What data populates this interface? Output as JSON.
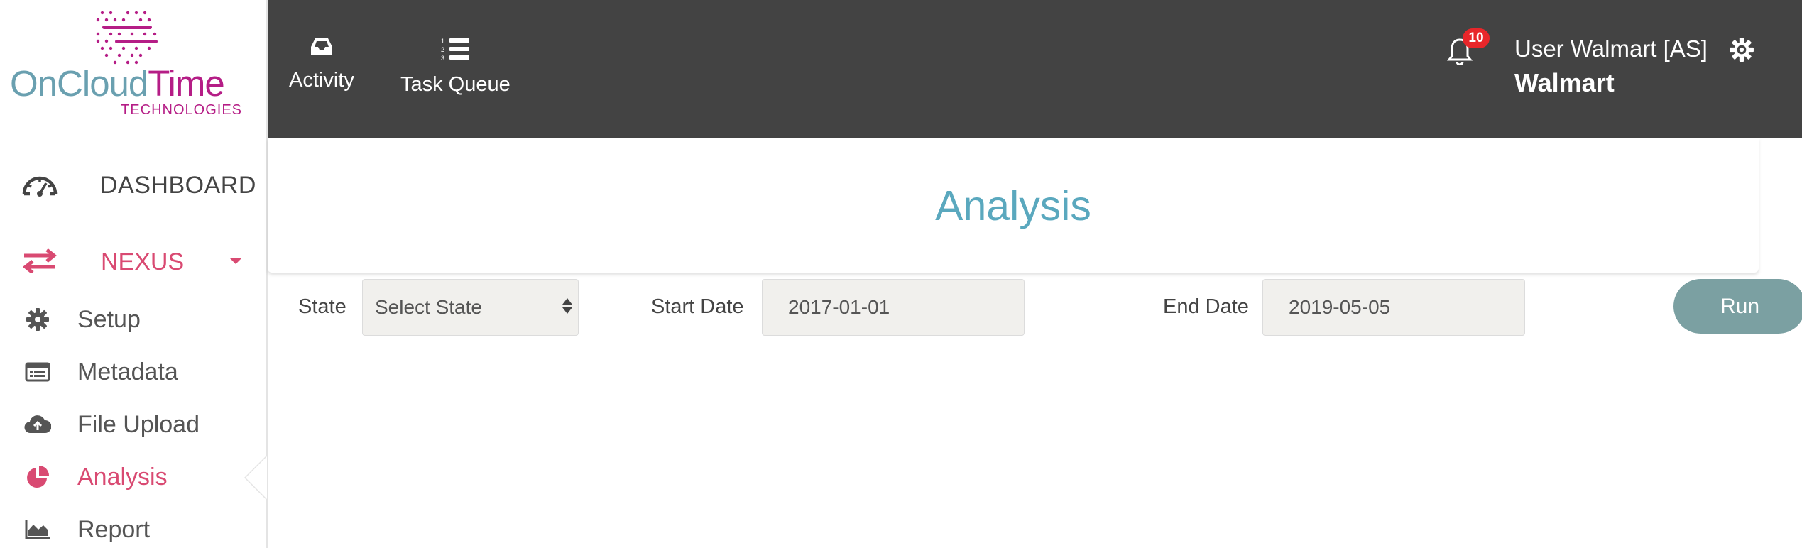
{
  "brand": {
    "name_part1": "OnCloud",
    "name_part2": "Time",
    "subtitle": "TECHNOLOGIES",
    "colors": {
      "primary": "#6aa0b0",
      "secondary": "#b51d86"
    }
  },
  "sidebar": {
    "dashboard": {
      "label": "DASHBOARD",
      "icon": "gauge-icon"
    },
    "nexus": {
      "label": "NEXUS",
      "icon": "exchange-arrows-icon",
      "color": "#d94a72"
    },
    "items": [
      {
        "label": "Setup",
        "icon": "gear-icon"
      },
      {
        "label": "Metadata",
        "icon": "list-card-icon"
      },
      {
        "label": "File Upload",
        "icon": "cloud-upload-icon"
      },
      {
        "label": "Analysis",
        "icon": "pie-chart-icon",
        "active": true
      },
      {
        "label": "Report",
        "icon": "area-chart-icon"
      }
    ]
  },
  "topbar": {
    "activity": {
      "label": "Activity",
      "icon": "inbox-icon"
    },
    "task_queue": {
      "label": "Task Queue",
      "icon": "numbered-list-icon"
    },
    "notifications": {
      "count": "10",
      "icon": "bell-icon"
    },
    "user": {
      "name": "User Walmart [AS]",
      "org": "Walmart"
    },
    "settings_icon": "gear-icon",
    "background": "#434343"
  },
  "main": {
    "title": "Analysis",
    "state": {
      "label": "State",
      "value": "Select State"
    },
    "start_date": {
      "label": "Start Date",
      "value": "2017-01-01"
    },
    "end_date": {
      "label": "End Date",
      "value": "2019-05-05"
    },
    "run_button": {
      "label": "Run",
      "color": "#7ba0a2"
    }
  }
}
